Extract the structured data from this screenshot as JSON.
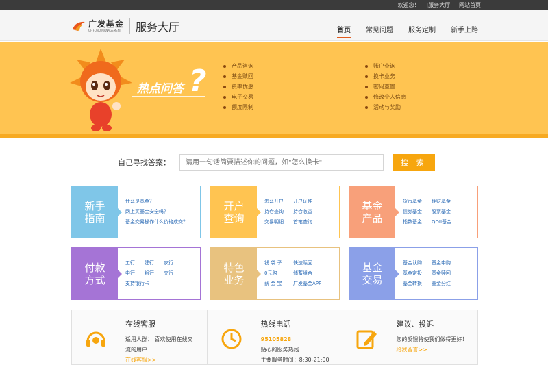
{
  "topbar": {
    "welcome": "欢迎您！",
    "service_hall": "服务大厅",
    "site_home": "网站首页"
  },
  "header": {
    "logo_cn": "广发基金",
    "logo_en": "GF FUND MANAGEMENT",
    "title": "服务大厅",
    "nav": [
      "首页",
      "常见问题",
      "服务定制",
      "新手上路"
    ]
  },
  "banner": {
    "title": "热点问答",
    "faq_left": [
      "产品咨询",
      "基金赎回",
      "费率优惠",
      "电子交易",
      "额度限制"
    ],
    "faq_right": [
      "账户查询",
      "换卡业务",
      "密码重置",
      "修改个人信息",
      "活动与奖励"
    ]
  },
  "search": {
    "label": "自己寻找答案：",
    "placeholder": "请用一句话简要描述你的问题，如\"怎么换卡\"",
    "button": "搜 索"
  },
  "cards": [
    {
      "title1": "新手",
      "title2": "指南",
      "color": "#7fc6e8",
      "border": "#7fc6e8",
      "rows": [
        [
          "什么是基金？"
        ],
        [
          "网上买基金安全吗？"
        ],
        [
          "基金交易操作什么价格成交？"
        ]
      ]
    },
    {
      "title1": "开户",
      "title2": "查询",
      "color": "#ffc451",
      "border": "#ffc451",
      "rows": [
        [
          "怎么开户",
          "开户证件"
        ],
        [
          "持仓查询",
          "持仓收益"
        ],
        [
          "交易明细",
          "首笔查询"
        ]
      ]
    },
    {
      "title1": "基金",
      "title2": "产品",
      "color": "#f8a07a",
      "border": "#f8a07a",
      "rows": [
        [
          "货币基金",
          "理财基金"
        ],
        [
          "债券基金",
          "股票基金"
        ],
        [
          "指数基金",
          "QDII基金"
        ]
      ]
    },
    {
      "title1": "付款",
      "title2": "方式",
      "color": "#a574d6",
      "border": "#a574d6",
      "rows": [
        [
          "工行",
          "建行",
          "农行"
        ],
        [
          "中行",
          "银行",
          "交行"
        ],
        [
          "支持银行卡"
        ]
      ]
    },
    {
      "title1": "特色",
      "title2": "业务",
      "color": "#e8c27f",
      "border": "#e8c27f",
      "rows": [
        [
          "钱 袋 子",
          "快速赎回"
        ],
        [
          "0元购",
          "储蓄组合"
        ],
        [
          "薪 金 宝",
          "广发基金APP"
        ]
      ]
    },
    {
      "title1": "基金",
      "title2": "交易",
      "color": "#8ba0e8",
      "border": "#8ba0e8",
      "rows": [
        [
          "基金认购",
          "基金申购"
        ],
        [
          "基金定投",
          "基金赎回"
        ],
        [
          "基金转换",
          "基金分红"
        ]
      ]
    }
  ],
  "service": [
    {
      "title": "在线客服",
      "lines": [
        "适用人群： 喜欢使用在线交",
        "流的用户"
      ],
      "link": "在线客服>>"
    },
    {
      "title": "热线电话",
      "hot": "95105828",
      "lines": [
        "贴心的服务热线",
        "主要服务时间：8:30-21:00"
      ]
    },
    {
      "title": "建议、投诉",
      "lines": [
        "您的反馈将使我们做得更好！"
      ],
      "link": "给我留言>>"
    }
  ],
  "colors": {
    "accent": "#f7a60e",
    "banner": "#ffc451",
    "nav_active": "#e15b1d"
  }
}
